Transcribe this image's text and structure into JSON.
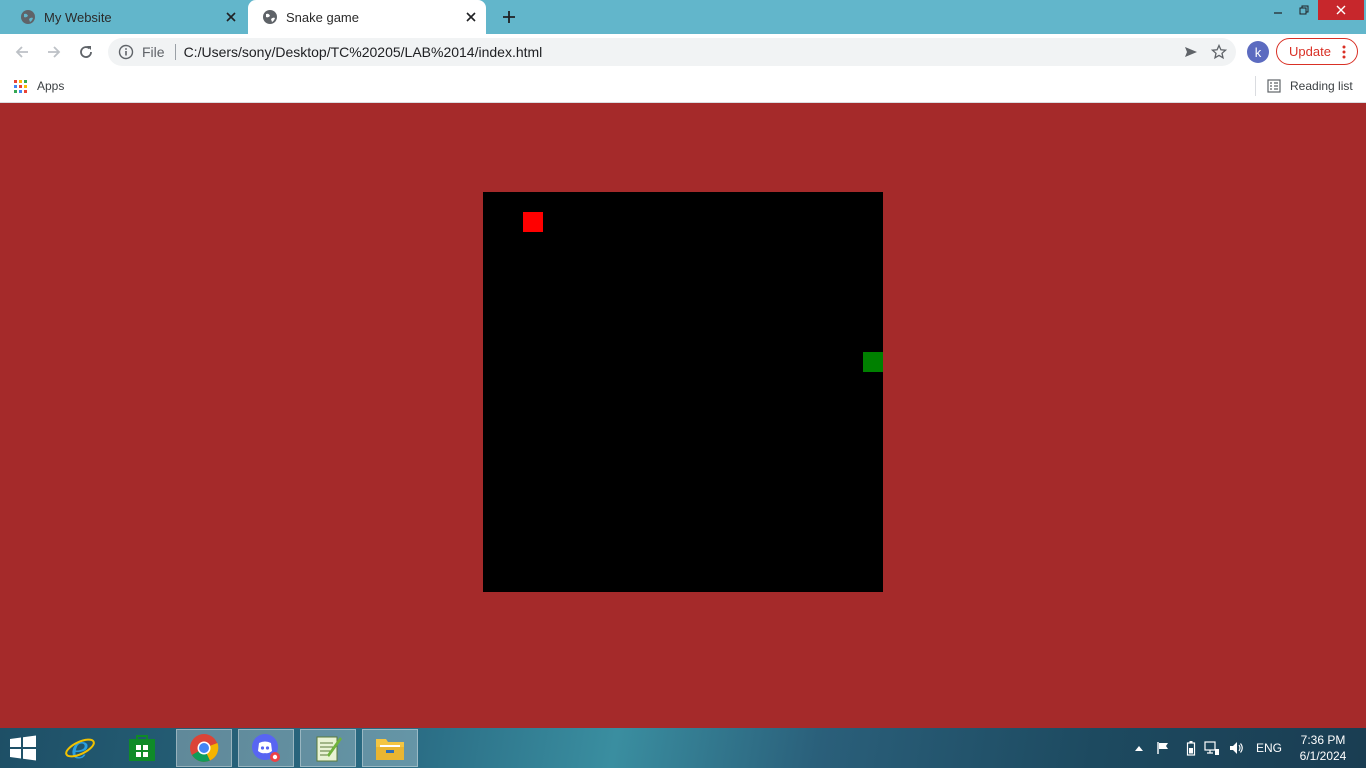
{
  "browser": {
    "tabs": [
      {
        "title": "My Website",
        "active": false
      },
      {
        "title": "Snake game",
        "active": true
      }
    ],
    "omnibox": {
      "scheme_label": "File",
      "url": "C:/Users/sony/Desktop/TC%20205/LAB%2014/index.html"
    },
    "profile_initial": "k",
    "update_label": "Update",
    "bookmarks": {
      "apps_label": "Apps",
      "reading_list_label": "Reading list"
    },
    "colors": {
      "tabstrip": "#62b6cb",
      "update_accent": "#d93025",
      "avatar": "#5c6bc0"
    }
  },
  "game": {
    "page_background": "#a52a2a",
    "board_color": "#000000",
    "grid_columns": 20,
    "grid_rows": 20,
    "food": {
      "col": 2,
      "row": 1,
      "color": "#ff0000"
    },
    "snake": [
      {
        "col": 19,
        "row": 8,
        "color": "#008000"
      }
    ]
  },
  "taskbar": {
    "apps": [
      "internet-explorer-icon",
      "store-icon",
      "chrome-icon",
      "discord-icon",
      "notepad-icon",
      "file-explorer-icon"
    ],
    "active_app": "chrome-icon",
    "language": "ENG",
    "time": "7:36 PM",
    "date": "6/1/2024"
  }
}
